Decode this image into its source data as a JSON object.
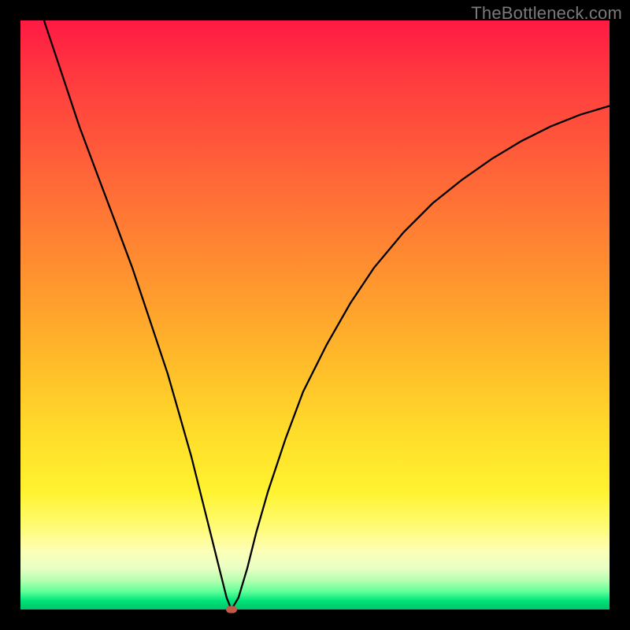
{
  "watermark": "TheBottleneck.com",
  "chart_data": {
    "type": "line",
    "title": "",
    "xlabel": "",
    "ylabel": "",
    "xlim": [
      0,
      100
    ],
    "ylim": [
      0,
      100
    ],
    "grid": false,
    "legend": false,
    "series": [
      {
        "name": "curve",
        "x": [
          4,
          7,
          10,
          13,
          16,
          19,
          22,
          25,
          27,
          29,
          31,
          32.5,
          34,
          35,
          35.8,
          37,
          38.5,
          40,
          42,
          45,
          48,
          52,
          56,
          60,
          65,
          70,
          75,
          80,
          85,
          90,
          95,
          100
        ],
        "values": [
          100,
          91,
          82,
          74,
          66,
          58,
          49,
          40,
          33,
          26,
          18,
          12,
          6,
          2,
          0,
          2,
          7,
          13,
          20,
          29,
          37,
          45,
          52,
          58,
          64,
          69,
          73,
          76.5,
          79.5,
          82,
          84,
          85.5
        ]
      }
    ],
    "marker": {
      "x": 35.8,
      "y": 0,
      "color": "#c25a4a"
    },
    "gradient_colors": {
      "top": "#ff1a44",
      "mid_upper": "#ff9a2e",
      "mid": "#ffdc2a",
      "mid_lower": "#fdffb6",
      "bottom": "#00c46a"
    }
  }
}
